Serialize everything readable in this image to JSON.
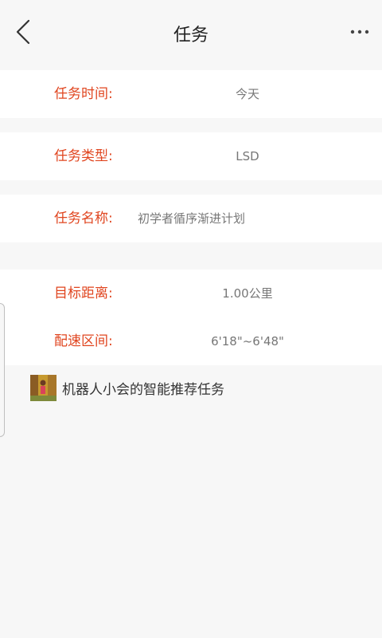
{
  "header": {
    "title": "任务",
    "back_icon": "chevron-left-icon",
    "more_icon": "more-horizontal-icon"
  },
  "rows": [
    {
      "label": "任务时间:",
      "value": "今天"
    },
    {
      "label": "任务类型:",
      "value": "LSD"
    },
    {
      "label": "任务名称:",
      "value": "初学者循序渐进计划"
    },
    {
      "label": "目标距离:",
      "value": "1.00公里"
    },
    {
      "label": "配速区间:",
      "value": "6'18\"~6'48\""
    }
  ],
  "recommend": {
    "text": "机器人小会的智能推荐任务"
  },
  "colors": {
    "accent": "#e0451f",
    "background": "#f7f7f7",
    "value_text": "#777777"
  }
}
